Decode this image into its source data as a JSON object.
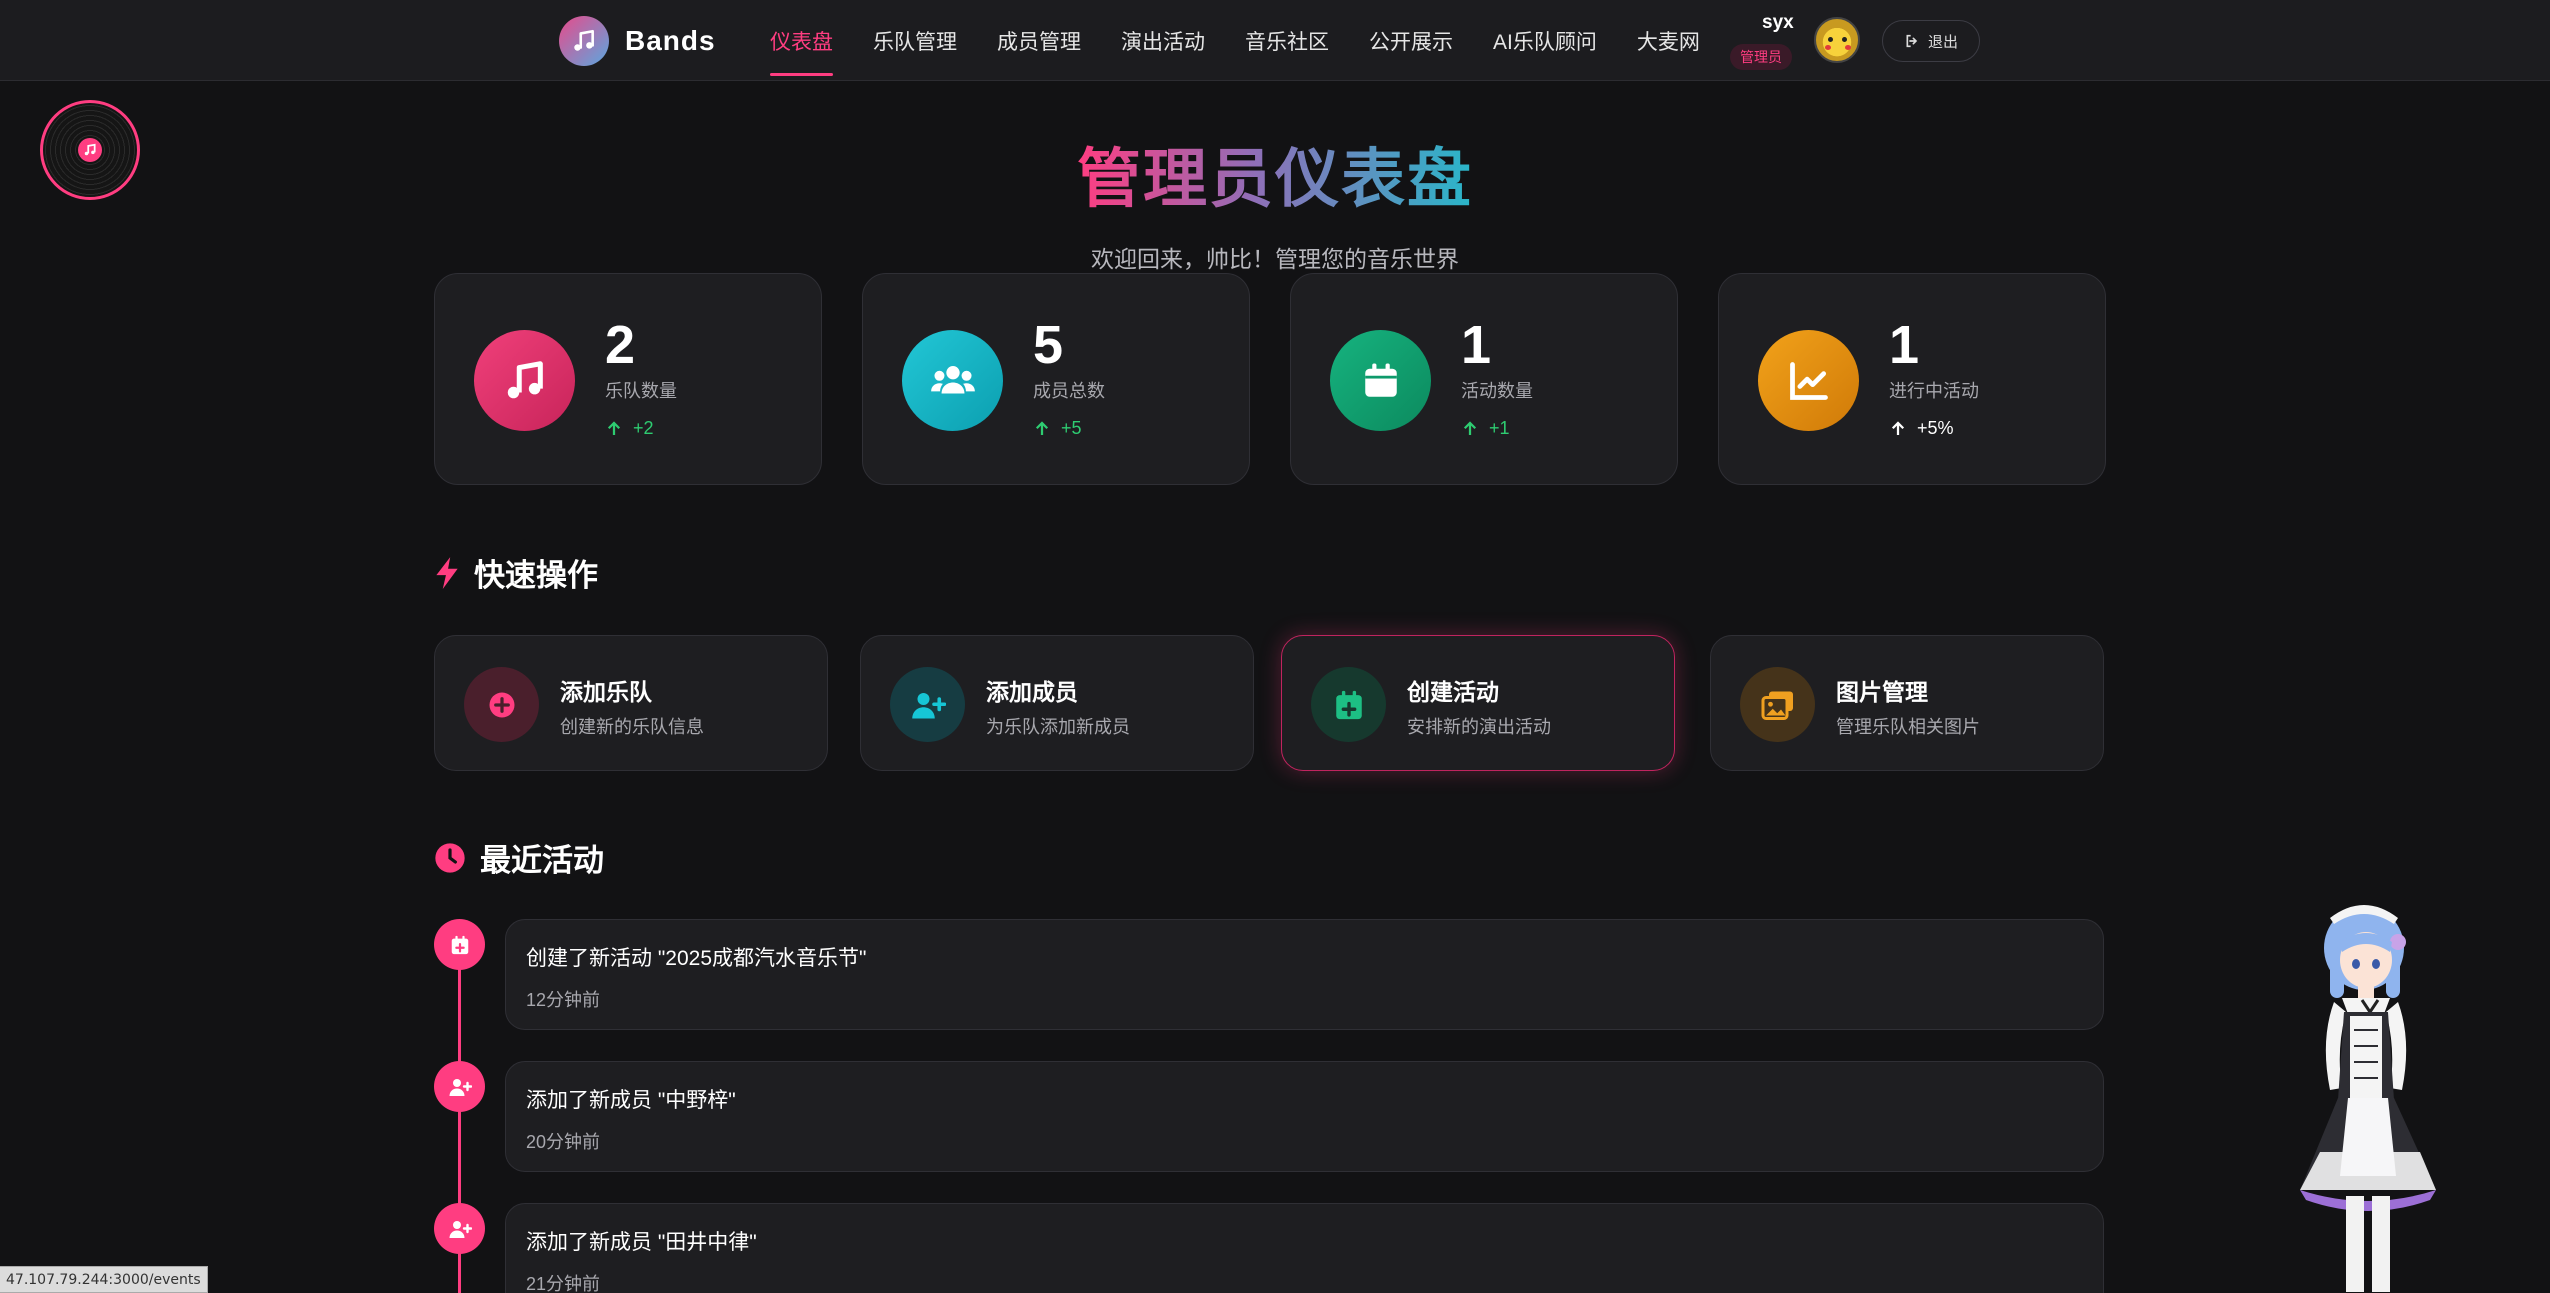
{
  "brand": {
    "name": "Bands",
    "icon": "music-note-icon"
  },
  "nav": {
    "items": [
      {
        "label": "仪表盘",
        "active": true
      },
      {
        "label": "乐队管理",
        "active": false
      },
      {
        "label": "成员管理",
        "active": false
      },
      {
        "label": "演出活动",
        "active": false
      },
      {
        "label": "音乐社区",
        "active": false
      },
      {
        "label": "公开展示",
        "active": false
      },
      {
        "label": "AI乐队顾问",
        "active": false
      },
      {
        "label": "大麦网",
        "active": false
      }
    ]
  },
  "user": {
    "name": "syx",
    "role": "管理员",
    "avatar": "pikachu-avatar",
    "logout_label": "退出"
  },
  "header": {
    "title": "管理员仪表盘",
    "subtitle": "欢迎回来，帅比！管理您的音乐世界"
  },
  "stats": [
    {
      "value": "2",
      "label": "乐队数量",
      "trend": "+2",
      "icon": "music-icon",
      "color": "#e8336f"
    },
    {
      "value": "5",
      "label": "成员总数",
      "trend": "+5",
      "icon": "users-icon",
      "color": "#16b5c7"
    },
    {
      "value": "1",
      "label": "活动数量",
      "trend": "+1",
      "icon": "calendar-icon",
      "color": "#10a877"
    },
    {
      "value": "1",
      "label": "进行中活动",
      "trend": "+5%",
      "icon": "chart-line-icon",
      "color": "#e89212"
    }
  ],
  "quick_actions": {
    "title": "快速操作",
    "icon": "bolt-icon",
    "items": [
      {
        "title": "添加乐队",
        "desc": "创建新的乐队信息",
        "icon": "plus-circle-icon",
        "color": "#ff3d81"
      },
      {
        "title": "添加成员",
        "desc": "为乐队添加新成员",
        "icon": "user-plus-icon",
        "color": "#16c6d6"
      },
      {
        "title": "创建活动",
        "desc": "安排新的演出活动",
        "icon": "calendar-plus-icon",
        "color": "#1dbf84"
      },
      {
        "title": "图片管理",
        "desc": "管理乐队相关图片",
        "icon": "images-icon",
        "color": "#f0a020"
      }
    ]
  },
  "recent": {
    "title": "最近活动",
    "icon": "clock-icon",
    "items": [
      {
        "title": "创建了新活动 \"2025成都汽水音乐节\"",
        "time": "12分钟前",
        "icon": "calendar-plus-icon"
      },
      {
        "title": "添加了新成员 \"中野梓\"",
        "time": "20分钟前",
        "icon": "user-plus-icon"
      },
      {
        "title": "添加了新成员 \"田井中律\"",
        "time": "21分钟前",
        "icon": "user-plus-icon"
      }
    ]
  },
  "status_bar": {
    "url": "47.107.79.244:3000/events"
  }
}
